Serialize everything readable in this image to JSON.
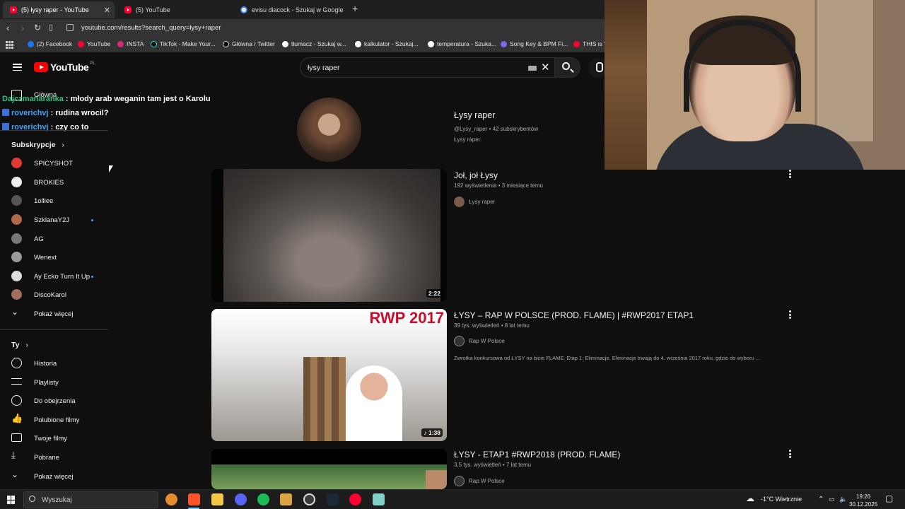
{
  "browser": {
    "tabs": [
      {
        "title": "(5) łysy raper - YouTube",
        "active": true,
        "favicon": "youtube-icon"
      },
      {
        "title": "(5) YouTube",
        "active": false,
        "favicon": "youtube-icon"
      },
      {
        "title": "evisu diacock - Szukaj w Google",
        "active": false,
        "favicon": "google-icon"
      }
    ],
    "url": "youtube.com/results?search_query=łysy+raper",
    "bookmarks": [
      {
        "label": "(2) Facebook",
        "color": "#1877f2"
      },
      {
        "label": "YouTube",
        "color": "#ff0033"
      },
      {
        "label": "INSTA",
        "color": "#d62976"
      },
      {
        "label": "TikTok - Make Your...",
        "color": "#000000"
      },
      {
        "label": "Główna / Twitter",
        "color": "#000000"
      },
      {
        "label": "tłumacz - Szukaj w...",
        "color": "#ffffff"
      },
      {
        "label": "kalkulator - Szukaj...",
        "color": "#ffffff"
      },
      {
        "label": "temperatura - Szuka...",
        "color": "#ffffff"
      },
      {
        "label": "Song Key & BPM Fi...",
        "color": "#7b68ee"
      },
      {
        "label": "THIS is W",
        "color": "#ff0033"
      }
    ]
  },
  "youtube": {
    "logo_text": "YouTube",
    "region": "PL",
    "search_query": "łysy raper",
    "sidebar": {
      "home_label": "Główna",
      "subscriptions_title": "Subskrypcje",
      "subscriptions": [
        {
          "label": "SPICYSHOT",
          "color": "#e53935",
          "new": false
        },
        {
          "label": "BROKIES",
          "color": "#eeeeee",
          "new": false
        },
        {
          "label": "1olliee",
          "color": "#555555",
          "new": false
        },
        {
          "label": "SzklanaY2J",
          "color": "#b06a4a",
          "new": true
        },
        {
          "label": "AG",
          "color": "#777777",
          "new": false
        },
        {
          "label": "Wenext",
          "color": "#999999",
          "new": false
        },
        {
          "label": "Ay Ecko Turn It Up",
          "color": "#dddddd",
          "new": true
        },
        {
          "label": "DiscoKarol",
          "color": "#a0705a",
          "new": false
        }
      ],
      "show_more": "Pokaż więcej",
      "you_title": "Ty",
      "you_items": [
        {
          "label": "Historia",
          "icon": "history-icon"
        },
        {
          "label": "Playlisty",
          "icon": "playlist-icon"
        },
        {
          "label": "Do obejrzenia",
          "icon": "watch-later-icon"
        },
        {
          "label": "Polubione filmy",
          "icon": "like-icon"
        },
        {
          "label": "Twoje filmy",
          "icon": "your-videos-icon"
        },
        {
          "label": "Pobrane",
          "icon": "download-icon"
        }
      ],
      "you_show_more": "Pokaż więcej"
    },
    "channel_result": {
      "name": "Łysy raper",
      "handle_meta": "@Lysy_raper • 42 subskrybentów",
      "description": "Łysy raper."
    },
    "videos": [
      {
        "title": "Joł, joł Łysy",
        "meta": "192 wyświetlenia • 3 miesiące temu",
        "channel": "Łysy raper",
        "duration": "2:22",
        "description": ""
      },
      {
        "title": "ŁYSY – RAP W POLSCE (PROD. FLAME) | #RWP2017 ETAP1",
        "meta": "39 tys. wyświetleń • 8 lat temu",
        "channel": "Rap W Polsce",
        "duration": "♪ 1:38",
        "description": "Zwrotka konkursowa od ŁYSY na bicie FLAME. Etap 1: Eliminacje. Eliminacje trwają do 4. września 2017 roku, gdzie do wyboru ...",
        "thumb_text": "RWP 2017"
      },
      {
        "title": "ŁYSY - ETAP1 #RWP2018 (PROD. FLAME)",
        "meta": "3,5 tys. wyświetleń • 7 lat temu",
        "channel": "Rap W Polsce",
        "duration": "",
        "description": ""
      }
    ]
  },
  "chat": [
    {
      "user": "Dajczmanaranka",
      "message": " : młody arab weganin tam jest o Karolu",
      "badge": false
    },
    {
      "user": "roverichvj",
      "message": " : rudina wrocil?",
      "badge": true
    },
    {
      "user": "roverichvj",
      "message": " : czy co to",
      "badge": true
    }
  ],
  "taskbar": {
    "search_placeholder": "Wyszukaj",
    "weather": "-1°C  Wietrznie",
    "time": "19:26",
    "date": "30.12.2025"
  }
}
